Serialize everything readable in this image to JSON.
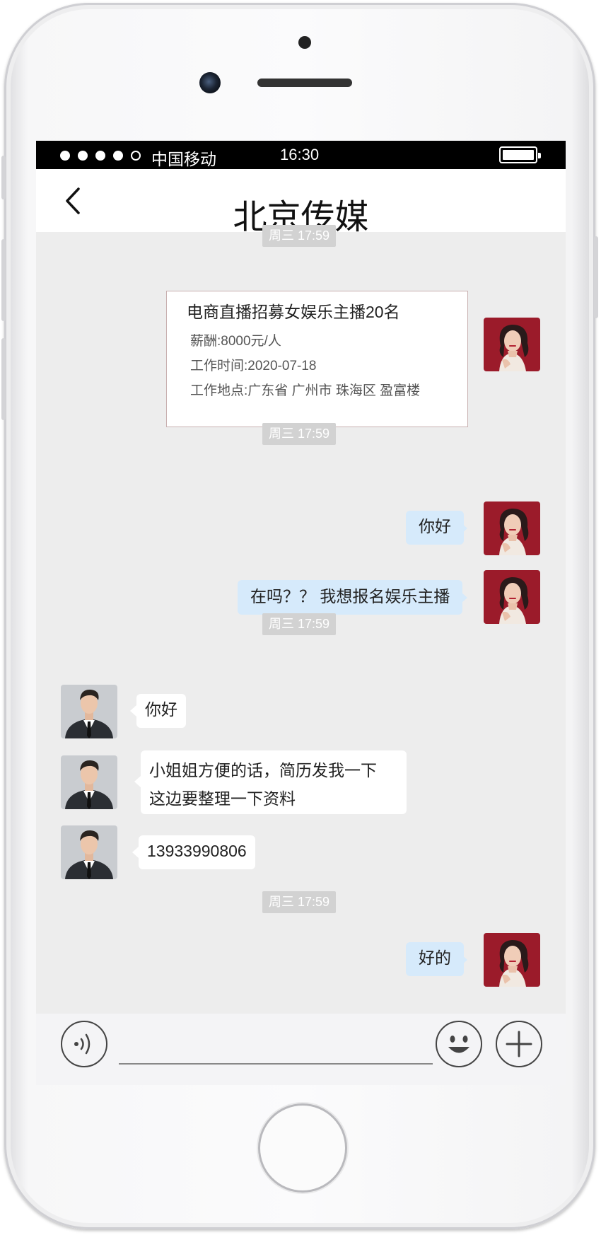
{
  "status_bar": {
    "carrier": "中国移动",
    "time": "16:30",
    "signal_bars": 4,
    "battery_level": 1.0
  },
  "header": {
    "title": "北京传媒",
    "back_icon": "chevron-left-icon"
  },
  "timestamps": [
    "周三 17:59",
    "周三 17:59",
    "周三 17:59",
    "周三 17:59"
  ],
  "job_card": {
    "title": "电商直播招募女娱乐主播20名",
    "salary": "薪酬:8000元/人",
    "work_time": "工作时间:2020-07-18",
    "location": "工作地点:广东省 广州市 珠海区 盈富楼"
  },
  "messages": [
    {
      "sender": "me",
      "text": "你好"
    },
    {
      "sender": "me",
      "text": "在吗？？ 我想报名娱乐主播"
    },
    {
      "sender": "other",
      "text": "你好"
    },
    {
      "sender": "other",
      "lines": [
        "小姐姐方便的话，简历发我一下",
        "这边要整理一下资料"
      ]
    },
    {
      "sender": "other",
      "text": "13933990806"
    },
    {
      "sender": "me",
      "text": "好的"
    }
  ],
  "input_bar": {
    "voice_icon": "voice-icon",
    "emoji_icon": "emoji-icon",
    "plus_icon": "plus-icon",
    "input_value": ""
  },
  "colors": {
    "my_bubble": "#d6eafb",
    "other_bubble": "#ffffff",
    "chat_background": "#ededed",
    "timestamp_bg": "#d2d2d2"
  }
}
